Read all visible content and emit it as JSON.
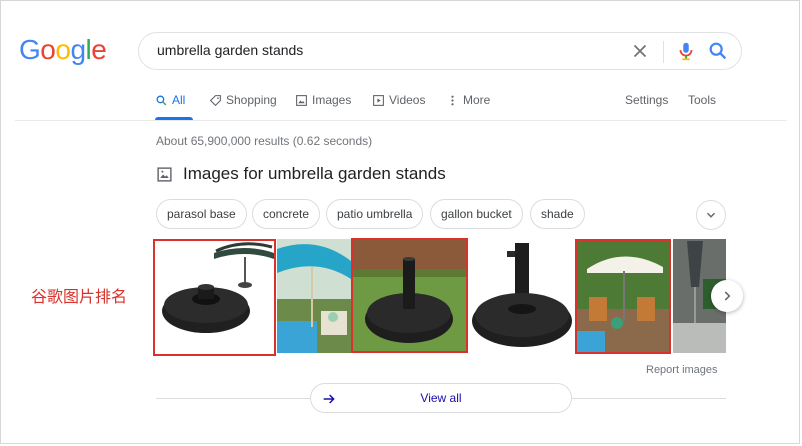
{
  "logo": {
    "letters": [
      "G",
      "o",
      "o",
      "g",
      "l",
      "e"
    ],
    "colors": [
      "#4285F4",
      "#EA4335",
      "#FBBC05",
      "#4285F4",
      "#34A853",
      "#EA4335"
    ]
  },
  "search": {
    "query": "umbrella garden stands",
    "clear_icon": "close-icon",
    "mic_icon": "mic-icon",
    "search_icon": "search-icon"
  },
  "tabs": [
    {
      "label": "All",
      "icon": "search-icon",
      "active": true
    },
    {
      "label": "Shopping",
      "icon": "tag-icon"
    },
    {
      "label": "Images",
      "icon": "image-icon"
    },
    {
      "label": "Videos",
      "icon": "play-icon"
    },
    {
      "label": "More",
      "icon": "more-vert-icon"
    }
  ],
  "tools": {
    "settings": "Settings",
    "tools": "Tools"
  },
  "stats": "About 65,900,000 results (0.62 seconds)",
  "images_section": {
    "heading": "Images for umbrella garden stands",
    "chips": [
      "parasol base",
      "concrete",
      "patio umbrella",
      "gallon bucket",
      "shade"
    ],
    "report": "Report images",
    "view_all": "View all"
  },
  "annotation": "谷歌图片排名",
  "colors": {
    "accent": "#1a73e8",
    "highlight": "#d9312b",
    "link": "#1a0dab"
  }
}
